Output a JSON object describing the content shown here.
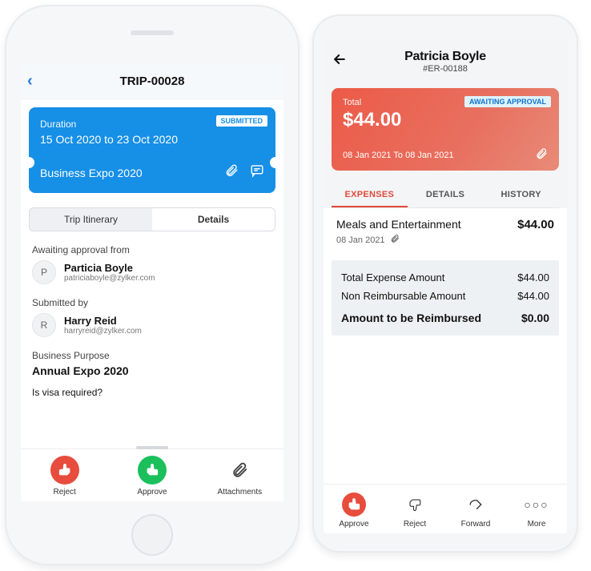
{
  "phone1": {
    "title": "TRIP-00028",
    "card": {
      "duration_label": "Duration",
      "date_range": "15 Oct 2020 to 23 Oct 2020",
      "status_badge": "SUBMITTED",
      "trip_name": "Business Expo 2020"
    },
    "segmented": {
      "itinerary": "Trip Itinerary",
      "details": "Details"
    },
    "awaiting_heading": "Awaiting approval from",
    "approver": {
      "initial": "P",
      "name": "Particia Boyle",
      "email": "patriciaboyle@zylker.com"
    },
    "submitted_heading": "Submitted by",
    "submitter": {
      "initial": "R",
      "name": "Harry Reid",
      "email": "harryreid@zylker.com"
    },
    "purpose_heading": "Business Purpose",
    "purpose_value": "Annual Expo 2020",
    "visa_heading": "Is visa required?",
    "actions": {
      "reject": "Reject",
      "approve": "Approve",
      "attachments": "Attachments"
    }
  },
  "phone2": {
    "person_name": "Patricia Boyle",
    "reference": "#ER-00188",
    "card": {
      "total_label": "Total",
      "amount": "$44.00",
      "status_badge": "AWAITING APPROVAL",
      "date_range": "08 Jan 2021  To  08 Jan 2021"
    },
    "tabs": {
      "expenses": "EXPENSES",
      "details": "DETAILS",
      "history": "HISTORY"
    },
    "expense_item": {
      "title": "Meals and Entertainment",
      "date": "08 Jan 2021",
      "amount": "$44.00"
    },
    "summary": {
      "total_label": "Total Expense Amount",
      "total_value": "$44.00",
      "nonreimb_label": "Non Reimbursable Amount",
      "nonreimb_value": "$44.00",
      "reimb_label": "Amount to be Reimbursed",
      "reimb_value": "$0.00"
    },
    "actions": {
      "approve": "Approve",
      "reject": "Reject",
      "forward": "Forward",
      "more": "More"
    }
  }
}
